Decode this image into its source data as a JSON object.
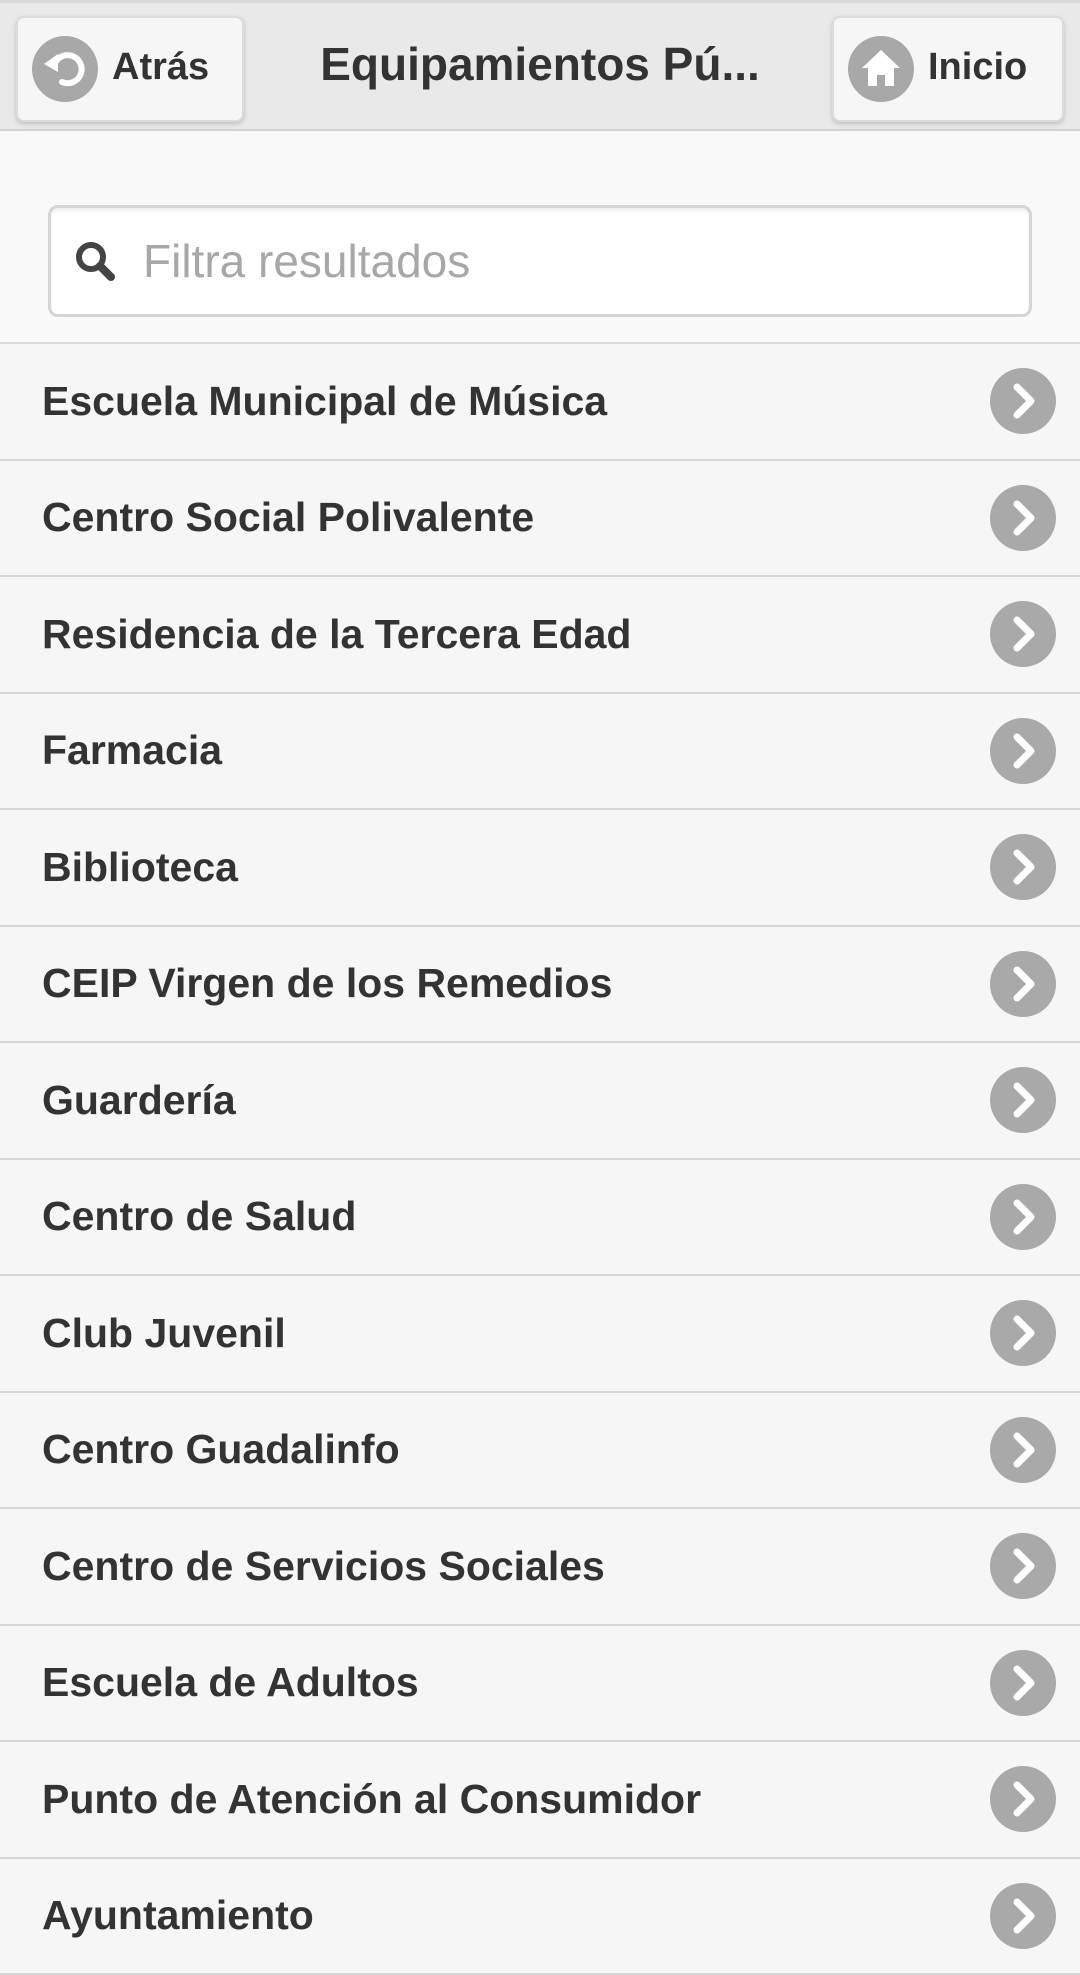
{
  "header": {
    "back_label": "Atrás",
    "title": "Equipamientos Pú...",
    "home_label": "Inicio"
  },
  "search": {
    "placeholder": "Filtra resultados",
    "value": ""
  },
  "list": {
    "items": [
      {
        "label": "Escuela Municipal de Música"
      },
      {
        "label": "Centro Social Polivalente"
      },
      {
        "label": "Residencia de la Tercera Edad"
      },
      {
        "label": "Farmacia"
      },
      {
        "label": "Biblioteca"
      },
      {
        "label": "CEIP Virgen de los Remedios"
      },
      {
        "label": "Guardería"
      },
      {
        "label": "Centro de Salud"
      },
      {
        "label": "Club Juvenil"
      },
      {
        "label": "Centro Guadalinfo"
      },
      {
        "label": "Centro de Servicios Sociales"
      },
      {
        "label": "Escuela de Adultos"
      },
      {
        "label": "Punto de Atención al Consumidor"
      },
      {
        "label": "Ayuntamiento"
      }
    ]
  },
  "icons": {
    "back": "back-arrow-icon",
    "home": "home-icon",
    "search": "search-icon",
    "chevron": "chevron-right-icon"
  },
  "colors": {
    "header_bg": "#e9e9e9",
    "list_bg": "#f6f6f6",
    "icon_circle": "#a9a9a9",
    "text": "#333333"
  }
}
